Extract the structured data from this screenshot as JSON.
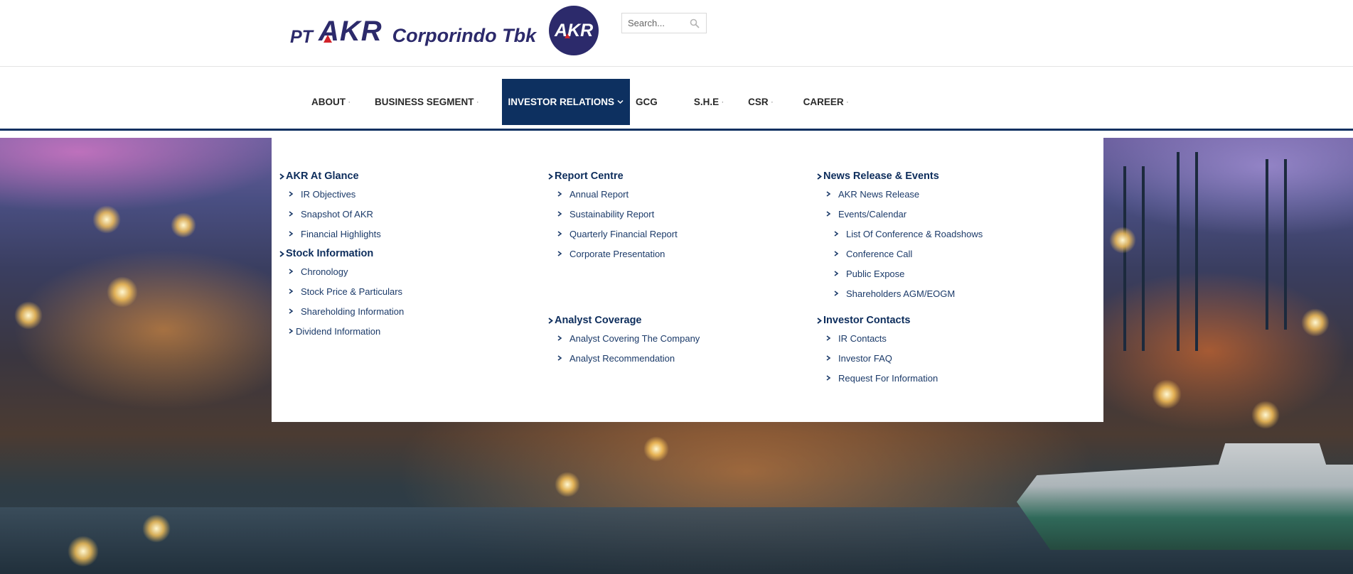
{
  "brand": {
    "prefix": "PT",
    "name": "AKR",
    "suffix": "Corporindo Tbk",
    "badge": "AKR"
  },
  "search": {
    "placeholder": "Search..."
  },
  "nav": {
    "items": [
      {
        "label": "ABOUT"
      },
      {
        "label": "BUSINESS SEGMENT"
      },
      {
        "label": "INVESTOR RELATIONS"
      },
      {
        "label": "GCG"
      },
      {
        "label": "S.H.E"
      },
      {
        "label": "CSR"
      },
      {
        "label": "CAREER"
      }
    ]
  },
  "menu": {
    "col1": {
      "g1": {
        "title": "AKR At Glance",
        "items": [
          "IR Objectives",
          "Snapshot Of AKR",
          "Financial Highlights"
        ]
      },
      "g2": {
        "title": "Stock Information",
        "items": [
          "Chronology",
          "Stock Price & Particulars",
          "Shareholding Information",
          "Dividend Information"
        ]
      }
    },
    "col2": {
      "g1": {
        "title": "Report Centre",
        "items": [
          "Annual Report",
          "Sustainability Report",
          "Quarterly Financial Report",
          "Corporate Presentation"
        ]
      },
      "g2": {
        "title": "Analyst Coverage",
        "items": [
          "Analyst Covering The Company",
          "Analyst Recommendation"
        ]
      }
    },
    "col3": {
      "g1": {
        "title": "News Release & Events",
        "items": [
          "AKR News Release",
          "Events/Calendar",
          "List Of Conference & Roadshows",
          "Conference Call",
          "Public Expose",
          "Shareholders AGM/EOGM"
        ]
      },
      "g2": {
        "title": "Investor Contacts",
        "items": [
          "IR Contacts",
          "Investor FAQ",
          "Request For Information"
        ]
      }
    }
  },
  "colors": {
    "brand_navy": "#2c2a6b",
    "brand_red": "#d2232a",
    "nav_active": "#0d3060",
    "menu_text": "#1b3a69"
  }
}
